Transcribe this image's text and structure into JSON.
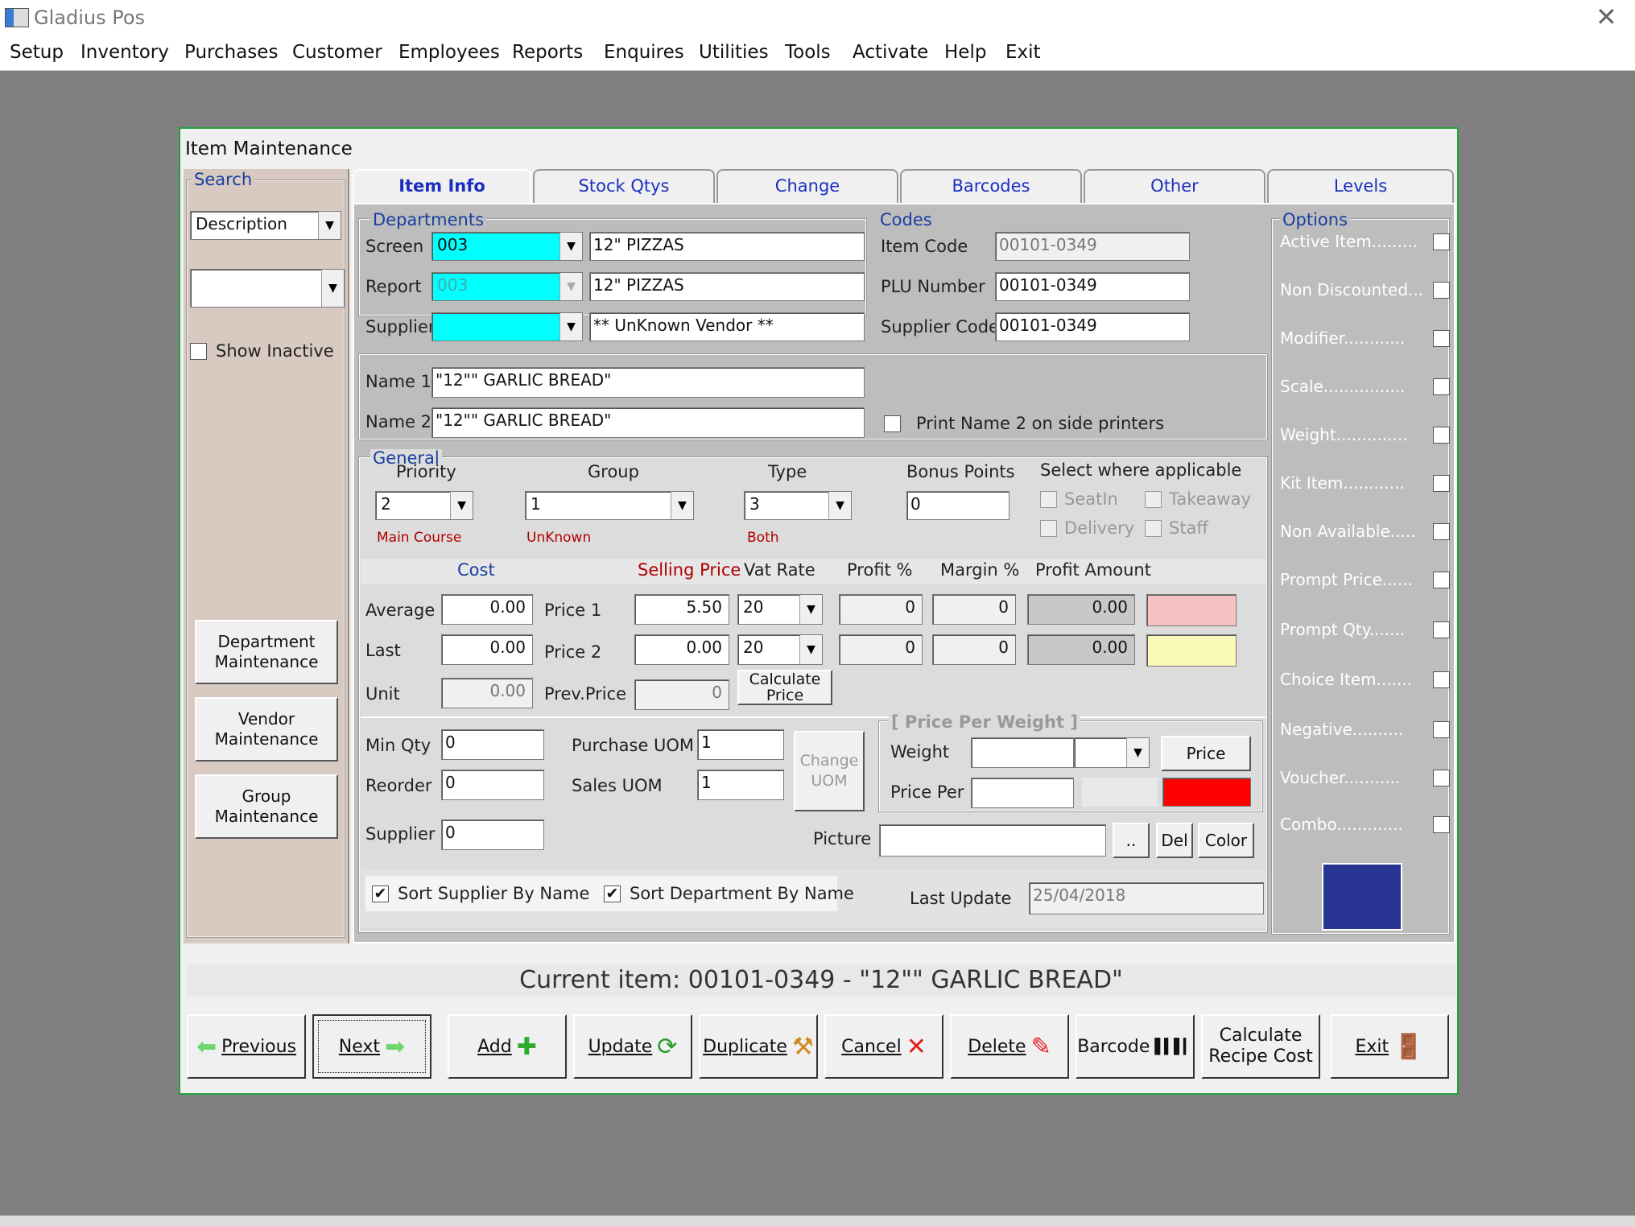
{
  "app": {
    "title": "Gladius Pos",
    "close": "✕"
  },
  "menu": [
    "Setup",
    "Inventory",
    "Purchases",
    "Customer",
    "Employees",
    "Reports",
    "Enquires",
    "Utilities",
    "Tools",
    "Activate",
    "Help",
    "Exit"
  ],
  "window": {
    "title": "Item Maintenance"
  },
  "search": {
    "label": "Search",
    "field": "Description",
    "value": "",
    "show_inactive": "Show Inactive",
    "btn_dept": "Department Maintenance",
    "btn_vendor": "Vendor Maintenance",
    "btn_group": "Group Maintenance"
  },
  "tabs": [
    "Item Info",
    "Stock Qtys",
    "Change",
    "Barcodes",
    "Other",
    "Levels"
  ],
  "departments": {
    "label": "Departments",
    "screen_label": "Screen",
    "screen_code": "003",
    "screen_name": "12\" PIZZAS",
    "report_label": "Report",
    "report_code": "003",
    "report_name": "12\" PIZZAS",
    "supplier_label": "Supplier",
    "supplier_code": "",
    "supplier_name": "** UnKnown Vendor **"
  },
  "codes": {
    "label": "Codes",
    "item_code_label": "Item Code",
    "item_code": "00101-0349",
    "plu_label": "PLU Number",
    "plu": "00101-0349",
    "supplier_code_label": "Supplier Code",
    "supplier_code": "00101-0349"
  },
  "names": {
    "name1_label": "Name 1",
    "name1": "\"12\"\" GARLIC BREAD\"",
    "name2_label": "Name 2",
    "name2": "\"12\"\" GARLIC BREAD\"",
    "print_name2": "Print Name 2 on side printers"
  },
  "general": {
    "label": "General",
    "priority_label": "Priority",
    "priority": "2",
    "priority_sub": "Main Course",
    "group_label": "Group",
    "group": "1",
    "group_sub": "UnKnown",
    "type_label": "Type",
    "type": "3",
    "type_sub": "Both",
    "bonus_label": "Bonus Points",
    "bonus": "0",
    "applicable_label": "Select where applicable",
    "seatin": "SeatIn",
    "takeaway": "Takeaway",
    "delivery": "Delivery",
    "staff": "Staff"
  },
  "pricing": {
    "cost_label": "Cost",
    "selling_label": "Selling Price",
    "vat_label": "Vat Rate",
    "profit_pct_label": "Profit %",
    "margin_label": "Margin %",
    "profit_amt_label": "Profit Amount",
    "average_label": "Average",
    "average": "0.00",
    "last_label": "Last",
    "last": "0.00",
    "unit_label": "Unit",
    "unit": "0.00",
    "price1_label": "Price 1",
    "price1": "5.50",
    "price2_label": "Price 2",
    "price2": "0.00",
    "prev_label": "Prev.Price",
    "prev": "0",
    "vat1": "20",
    "vat2": "20",
    "profit1": "0",
    "profit2": "0",
    "margin1": "0",
    "margin2": "0",
    "amt1": "0.00",
    "amt2": "0.00",
    "calc_btn": "Calculate Price",
    "color1": "#f7c1c1",
    "color2": "#fbf9b8"
  },
  "qty": {
    "min_label": "Min Qty",
    "min": "0",
    "reorder_label": "Reorder",
    "reorder": "0",
    "supplier_pct_label": "Supplier %",
    "supplier_pct": "0",
    "purchase_uom_label": "Purchase UOM",
    "purchase_uom": "1",
    "sales_uom_label": "Sales UOM",
    "sales_uom": "1",
    "change_uom": "Change UOM"
  },
  "ppw": {
    "label": "[ Price Per Weight ]",
    "weight_label": "Weight",
    "price_per_label": "Price Per",
    "price_btn": "Price",
    "color": "#ff0000"
  },
  "picture": {
    "label": "Picture",
    "value": "",
    "browse": "..",
    "del": "Del",
    "color": "Color"
  },
  "sort": {
    "supplier": "Sort Supplier By Name",
    "department": "Sort Department By Name",
    "last_update_label": "Last Update",
    "last_update": "25/04/2018"
  },
  "options": {
    "label": "Options",
    "items": [
      {
        "label": "Active Item.........",
        "checked": true
      },
      {
        "label": "Non Discounted...",
        "checked": false
      },
      {
        "label": "Modifier............",
        "checked": false
      },
      {
        "label": "Scale................",
        "checked": false
      },
      {
        "label": "Weight..............",
        "checked": false
      },
      {
        "label": "Kit Item............",
        "checked": false
      },
      {
        "label": "Non Available.....",
        "checked": false
      },
      {
        "label": "Prompt Price......",
        "checked": false
      },
      {
        "label": "Prompt Qty.......",
        "checked": false
      },
      {
        "label": "Choice Item.......",
        "checked": false
      },
      {
        "label": "Negative..........",
        "checked": false
      },
      {
        "label": "Voucher...........",
        "checked": false
      },
      {
        "label": "Combo.............",
        "checked": false
      }
    ],
    "swatch": "#283593"
  },
  "status": "Current item: 00101-0349 - \"12\"\" GARLIC BREAD\"",
  "toolbar": {
    "previous": "Previous",
    "next": "Next",
    "add": "Add",
    "update": "Update",
    "duplicate": "Duplicate",
    "cancel": "Cancel",
    "delete": "Delete",
    "barcode": "Barcode",
    "calc_recipe": "Calculate Recipe Cost",
    "exit": "Exit"
  }
}
